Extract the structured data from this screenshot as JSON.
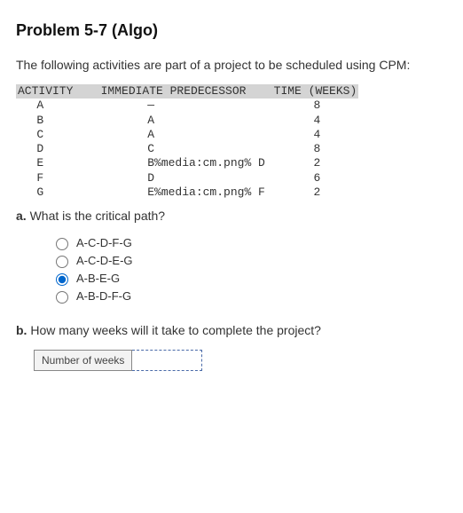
{
  "title": "Problem 5-7 (Algo)",
  "intro": "The following activities are part of a project to be scheduled using CPM:",
  "table": {
    "header": "ACTIVITY    IMMEDIATE PREDECESSOR    TIME (WEEKS)",
    "rows": [
      "   A               —                       8",
      "   B               A                       4",
      "   C               A                       4",
      "   D               C                       8",
      "   E               B%media:cm.png% D       2",
      "   F               D                       6",
      "   G               E%media:cm.png% F       2"
    ]
  },
  "questions": {
    "a": {
      "prefix": "a.",
      "text": " What is the critical path?",
      "options": [
        {
          "label": "A-C-D-F-G",
          "checked": false
        },
        {
          "label": "A-C-D-E-G",
          "checked": false
        },
        {
          "label": "A-B-E-G",
          "checked": true
        },
        {
          "label": "A-B-D-F-G",
          "checked": false
        }
      ]
    },
    "b": {
      "prefix": "b.",
      "text": " How many weeks will it take to complete the project?",
      "input_label": "Number of weeks",
      "input_value": ""
    }
  }
}
